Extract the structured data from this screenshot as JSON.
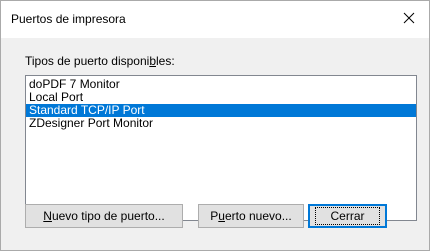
{
  "window": {
    "title": "Puertos de impresora",
    "close_glyph": "✕"
  },
  "list": {
    "label_before": "Tipos de puerto disponi",
    "label_mnemonic": "b",
    "label_after": "les:",
    "items": [
      "doPDF 7 Monitor",
      "Local Port",
      "Standard TCP/IP Port",
      "ZDesigner Port Monitor"
    ],
    "selected_index": 2
  },
  "buttons": {
    "new_type_mnemonic": "N",
    "new_type_rest": "uevo tipo de puerto...",
    "new_port_first": "P",
    "new_port_mnemonic": "u",
    "new_port_rest": "erto nuevo...",
    "close": "Cerrar"
  },
  "colors": {
    "selection": "#0078d7",
    "dialog_bg": "#f0f0f0"
  }
}
